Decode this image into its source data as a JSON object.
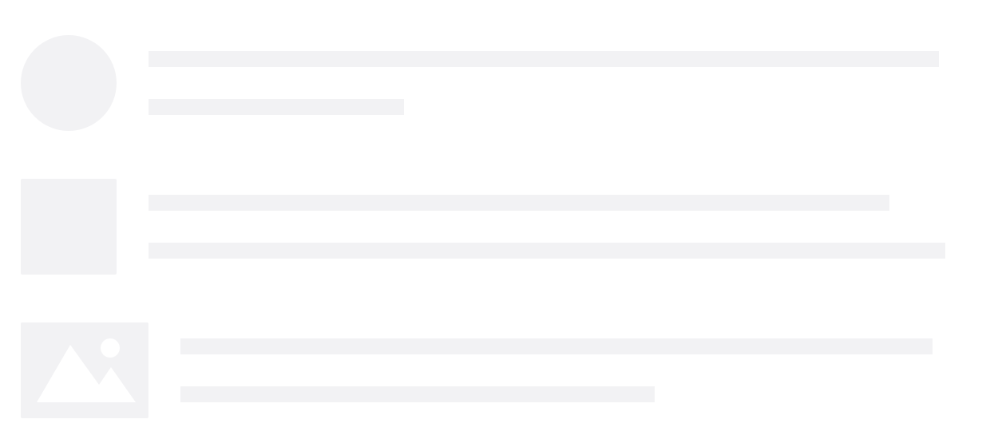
{
  "placeholder": {
    "color": "#f2f2f4",
    "background": "#ffffff",
    "rows": [
      {
        "media": "avatar-circle",
        "lines": 2
      },
      {
        "media": "square-thumbnail",
        "lines": 2
      },
      {
        "media": "image-icon",
        "lines": 2
      }
    ]
  }
}
